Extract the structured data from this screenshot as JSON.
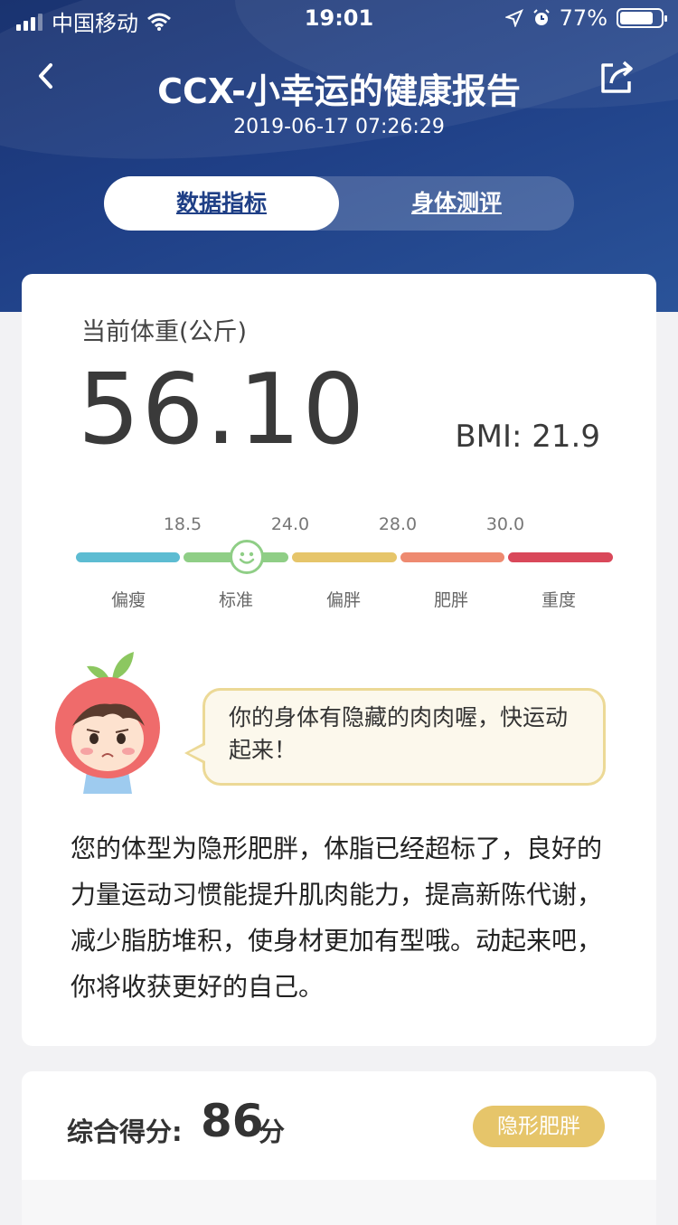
{
  "status_bar": {
    "carrier": "中国移动",
    "time": "19:01",
    "battery": "77%"
  },
  "header": {
    "title": "CCX-小幸运的健康报告",
    "datetime": "2019-06-17 07:26:29",
    "back_icon": "chevron-left-icon",
    "share_icon": "share-icon"
  },
  "tabs": [
    {
      "label": "数据指标",
      "active": true
    },
    {
      "label": "身体测评",
      "active": false
    }
  ],
  "weight": {
    "label": "当前体重(公斤)",
    "value": "56.10",
    "bmi_label": "BMI: 21.9",
    "bmi_value": 21.9
  },
  "bmi_scale": {
    "ticks": [
      "18.5",
      "24.0",
      "28.0",
      "30.0"
    ],
    "categories": [
      "偏瘦",
      "标准",
      "偏胖",
      "肥胖",
      "重度"
    ],
    "colors": [
      "#5dbcd2",
      "#8fce86",
      "#e6c56a",
      "#ee8a70",
      "#d9485a"
    ],
    "current_category": "标准"
  },
  "advice": {
    "bubble": "你的身体有隐藏的肉肉喔，快运动起来！",
    "description": "您的体型为隐形肥胖，体脂已经超标了，良好的力量运动习惯能提升肌肉能力，提高新陈代谢，减少脂肪堆积，使身材更加有型哦。动起来吧，你将收获更好的自己。"
  },
  "score": {
    "label": "综合得分:",
    "value": "86",
    "unit": "分",
    "badge": "隐形肥胖",
    "badge_color": "#e6c56a"
  }
}
